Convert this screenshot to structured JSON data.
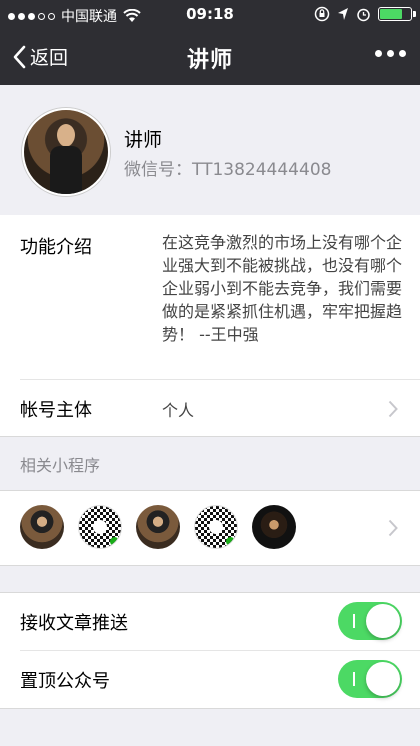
{
  "status_bar": {
    "carrier": "中国联通",
    "time": "09:18",
    "icons": [
      "signal-dots-icon",
      "wifi-icon",
      "lock-rotation-icon",
      "location-icon",
      "alarm-icon",
      "battery-icon"
    ]
  },
  "nav": {
    "back_label": "返回",
    "title": "讲师",
    "more_icon": "more-dots-icon"
  },
  "profile": {
    "name": "讲师",
    "wechat_id": "微信号：TT13824444408"
  },
  "info": {
    "intro_label": "功能介绍",
    "intro_text": "在这竞争激烈的市场上没有哪个企业强大到不能被挑战，也没有哪个企业弱小到不能去竞争，我们需要做的是紧紧抓住机遇，牢牢把握趋势！ --王中强",
    "owner_label": "帐号主体",
    "owner_value": "个人"
  },
  "mini_programs": {
    "header": "相关小程序",
    "count": 5
  },
  "toggles": [
    {
      "label": "接收文章推送",
      "on": true
    },
    {
      "label": "置顶公众号",
      "on": true
    }
  ],
  "colors": {
    "nav_bg": "#2e2e33",
    "page_bg": "#efeff4",
    "switch_on": "#4cd964",
    "secondary_text": "#8a8a8f"
  }
}
